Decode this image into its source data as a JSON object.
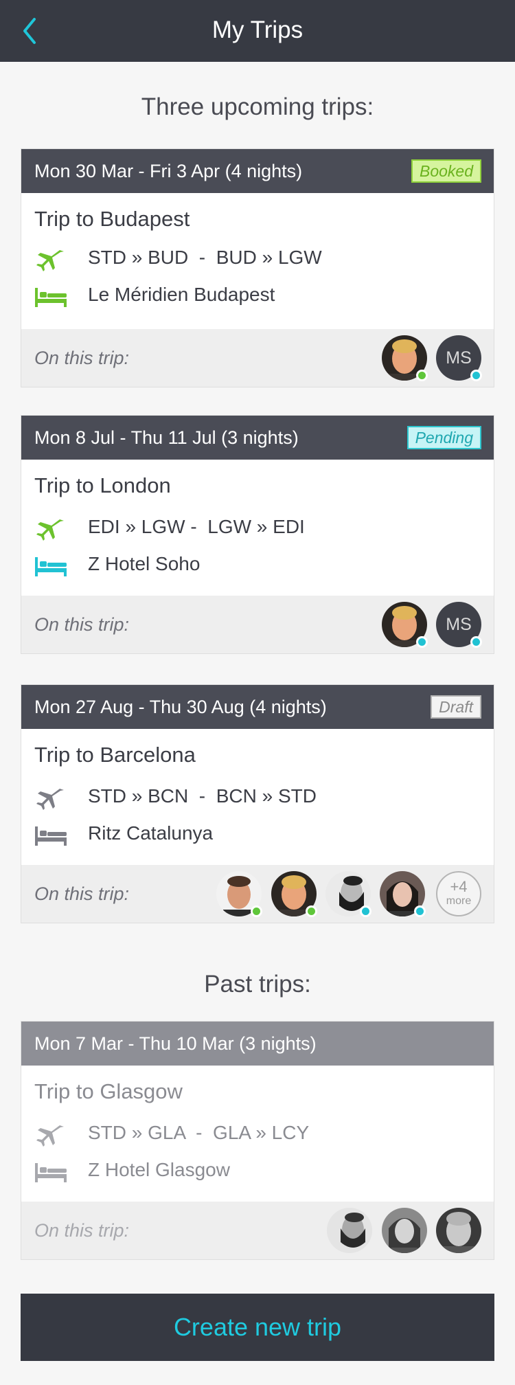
{
  "header": {
    "title": "My Trips"
  },
  "upcoming_title": "Three upcoming trips:",
  "past_title": "Past trips:",
  "trips": [
    {
      "dates": "Mon 30 Mar - Fri 3 Apr (4 nights)",
      "status": "Booked",
      "title": "Trip to Budapest",
      "flight": "STD » BUD  -  BUD » LGW",
      "hotel": "Le Méridien Budapest",
      "on_trip_label": "On this trip:",
      "icon_color": "#6cc22d",
      "travellers": [
        {
          "type": "photo",
          "status_color": "#5fc63a"
        },
        {
          "type": "initials",
          "initials": "MS",
          "status_color": "#21c2d3"
        }
      ]
    },
    {
      "dates": "Mon 8 Jul - Thu 11 Jul (3 nights)",
      "status": "Pending",
      "title": "Trip to London",
      "flight": "EDI » LGW -  LGW » EDI",
      "hotel": "Z Hotel Soho",
      "on_trip_label": "On this trip:",
      "icon_color_flight": "#6cc22d",
      "icon_color_hotel": "#21c2d3",
      "travellers": [
        {
          "type": "photo",
          "status_color": "#21c2d3"
        },
        {
          "type": "initials",
          "initials": "MS",
          "status_color": "#21c2d3"
        }
      ]
    },
    {
      "dates": "Mon 27 Aug - Thu 30 Aug (4 nights)",
      "status": "Draft",
      "title": "Trip to Barcelona",
      "flight": "STD » BCN  -  BCN » STD",
      "hotel": "Ritz Catalunya",
      "on_trip_label": "On this trip:",
      "icon_color": "#8a8b91",
      "more_count": "+4",
      "more_label": "more"
    },
    {
      "dates": "Mon 7 Mar - Thu 10 Mar (3 nights)",
      "title": "Trip to Glasgow",
      "flight": "STD » GLA  -  GLA » LCY",
      "hotel": "Z Hotel Glasgow",
      "on_trip_label": "On this trip:",
      "icon_color": "#a7a8ad"
    }
  ],
  "create_button": "Create new trip"
}
